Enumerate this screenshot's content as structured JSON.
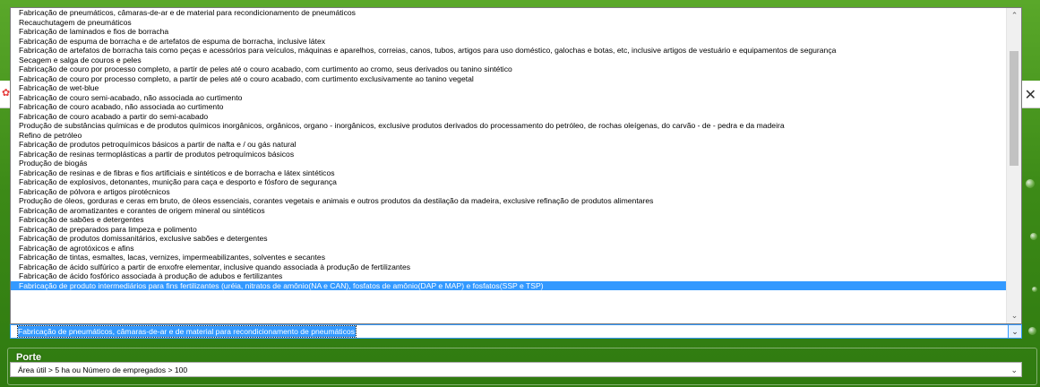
{
  "options": [
    "Fabricação de pneumáticos, câmaras-de-ar e de material para recondicionamento de pneumáticos",
    "Recauchutagem de pneumáticos",
    "Fabricação de laminados e fios de borracha",
    "Fabricação de espuma de borracha e de artefatos de espuma de borracha, inclusive látex",
    "Fabricação de artefatos de borracha tais como peças e acessórios para veículos, máquinas e aparelhos, correias, canos, tubos, artigos para uso doméstico, galochas e botas, etc, inclusive artigos de vestuário e equipamentos de segurança",
    "Secagem e salga de couros e peles",
    "Fabricação de couro por processo completo, a partir de peles até o couro acabado, com curtimento ao cromo, seus derivados ou tanino sintético",
    "Fabricação de couro por processo completo, a partir de peles até o couro acabado, com curtimento exclusivamente ao tanino vegetal",
    "Fabricação de wet-blue",
    "Fabricação de couro semi-acabado, não associada ao curtimento",
    "Fabricação de couro acabado, não associada ao curtimento",
    "Fabricação de couro acabado a partir do semi-acabado",
    "Produção de substâncias químicas e de produtos químicos inorgânicos, orgânicos, organo - inorgânicos, exclusive produtos derivados do processamento do petróleo, de rochas oleígenas, do carvão - de - pedra e da madeira",
    "Refino de petróleo",
    "Fabricação de produtos petroquímicos básicos a partir de nafta e / ou gás natural",
    "Fabricação de resinas termoplásticas a partir de produtos petroquímicos básicos",
    "Produção de biogás",
    "Fabricação de resinas e de fibras e fios artificiais e sintéticos e de borracha e látex sintéticos",
    "Fabricação de explosivos, detonantes, munição para caça e desporto e fósforo de segurança",
    "Fabricação de pólvora e artigos pirotécnicos",
    "Produção de óleos, gorduras e ceras em bruto, de óleos essenciais, corantes vegetais e animais e outros produtos da destilação da madeira, exclusive refinação de produtos alimentares",
    "Fabricação de aromatizantes e corantes de origem mineral ou sintéticos",
    "Fabricação de sabões e detergentes",
    "Fabricação de preparados para limpeza e polimento",
    "Fabricação de produtos domissanitários, exclusive sabões e detergentes",
    "Fabricação de agrotóxicos e afins",
    "Fabricação de tintas, esmaltes, lacas, vernizes, impermeabilizantes, solventes e secantes",
    "Fabricação de ácido sulfúrico a partir de enxofre elementar, inclusive quando associada à produção de fertilizantes",
    "Fabricação de ácido fosfórico associada à produção de adubos e fertilizantes",
    "Fabricação de produto intermediários para fins fertilizantes (uréia, nitratos de amônio(NA e CAN), fosfatos de amônio(DAP e MAP) e fosfatos(SSP e TSP)"
  ],
  "highlighted_index": 29,
  "combo": {
    "selected_value": "Fabricação de pneumáticos, câmaras-de-ar e de material para recondicionamento de pneumáticos"
  },
  "porte": {
    "label": "Porte",
    "selected_value": "Área útil > 5 ha ou Número de empregados > 100"
  },
  "icons": {
    "close": "close-icon",
    "scroll_up": "chevron-up-icon",
    "scroll_down": "chevron-down-icon",
    "combo_dropdown": "chevron-down-icon"
  },
  "colors": {
    "selection": "#3399ff",
    "background_green": "#3f8f1a"
  }
}
